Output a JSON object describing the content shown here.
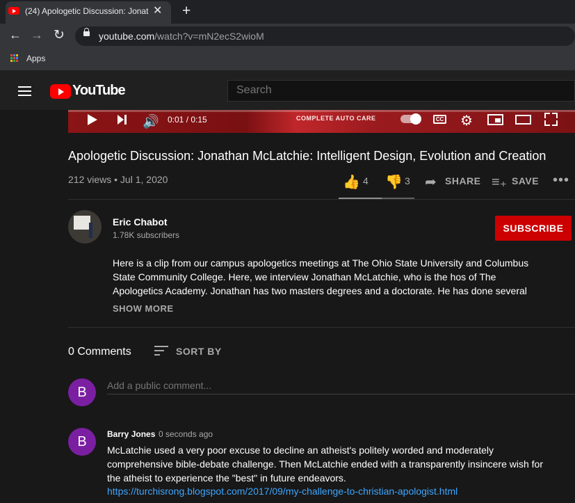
{
  "browser": {
    "tab_title": "(24) Apologetic Discussion: Jonat",
    "tab_close": "✕",
    "new_tab": "+",
    "url_host": "youtube.com",
    "url_path": "/watch?v=mN2ecS2wioM",
    "bookmarks": {
      "apps_label": "Apps"
    }
  },
  "header": {
    "logo_text": "YouTube",
    "search_placeholder": "Search"
  },
  "player": {
    "time": "0:01 / 0:15",
    "ad_text": "COMPLETE AUTO CARE",
    "cc_label": "CC"
  },
  "video": {
    "title": "Apologetic Discussion: Jonathan McLatchie: Intelligent Design, Evolution and Creation",
    "meta": "212 views • Jul 1, 2020",
    "likes": "4",
    "dislikes": "3",
    "share_label": "SHARE",
    "save_label": "SAVE",
    "more": "•••"
  },
  "channel": {
    "name": "Eric Chabot",
    "subscribers": "1.78K subscribers",
    "subscribe_label": "SUBSCRIBE",
    "description": "Here  is a clip from our campus apologetics meetings at The Ohio State University and Columbus State Community College. Here, we interview Jonathan McLatchie, who is the hos of The Apologetics Academy. Jonathan has two masters degrees and a doctorate. He has done several",
    "show_more": "SHOW MORE"
  },
  "comments": {
    "count_label": "0 Comments",
    "sort_label": "SORT BY",
    "user_initial": "B",
    "input_placeholder": "Add a public comment...",
    "items": [
      {
        "initial": "B",
        "author": "Barry Jones",
        "time": "0 seconds ago",
        "text": "McLatchie used a very poor excuse to decline an atheist's politely worded and moderately comprehensive bible-debate challenge.  Then McLatchie ended with a transparently insincere wish for the atheist to experience the \"best\" in future endeavors.",
        "link": "https://turchisrong.blogspot.com/2017/09/my-challenge-to-christian-apologist.html"
      }
    ]
  },
  "colors": {
    "brand_red": "#ff0000",
    "subscribe_red": "#cc0000",
    "avatar_purple": "#7b1fa2",
    "link_blue": "#3ea6ff",
    "background": "#181818"
  },
  "icons": [
    "youtube-favicon",
    "close-icon",
    "plus-icon",
    "back-icon",
    "forward-icon",
    "reload-icon",
    "lock-icon",
    "apps-icon",
    "menu-icon",
    "youtube-logo",
    "play-icon",
    "next-icon",
    "volume-icon",
    "autoplay-toggle",
    "cc-icon",
    "settings-icon",
    "miniplayer-icon",
    "theater-icon",
    "fullscreen-icon",
    "thumbs-up-icon",
    "thumbs-down-icon",
    "share-icon",
    "playlist-add-icon",
    "more-icon",
    "sort-icon"
  ]
}
